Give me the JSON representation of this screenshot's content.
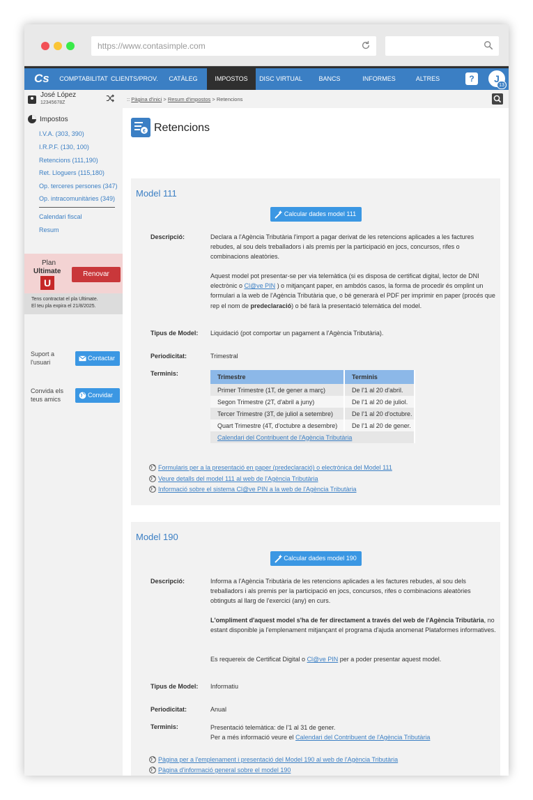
{
  "browser": {
    "url": "https://www.contasimple.com"
  },
  "nav": {
    "logo": "Cs",
    "items": [
      "COMPTABILITAT",
      "CLIENTS/PROV.",
      "CATÀLEG",
      "IMPOSTOS",
      "DISC VIRTUAL",
      "BANCS",
      "INFORMES",
      "ALTRES"
    ],
    "active": "IMPOSTOS",
    "help": "?",
    "avatar_initial": "J",
    "avatar_badge": "13"
  },
  "sidebar": {
    "user_name": "José López",
    "user_id": "12345678Z",
    "section_title": "Impostos",
    "links": [
      "I.V.A. (303, 390)",
      "I.R.P.F. (130, 100)",
      "Retencions (111,190)",
      "Ret. Lloguers (115,180)",
      "Op. terceres persones (347)",
      "Op. intracomunitàries (349)"
    ],
    "links2": [
      "Calendari fiscal",
      "Resum"
    ],
    "plan_label": "Plan",
    "plan_name": "Ultimate",
    "plan_badge": "U",
    "renew": "Renovar",
    "plan_note_1": "Tens contractat el pla Ultimate.",
    "plan_note_2": "El teu pla expira el 21/8/2025.",
    "support_1": "Suport a",
    "support_2": "l'usuari",
    "contact": "Contactar",
    "invite_1": "Convida els",
    "invite_2": "teus amics",
    "invite": "Convidar"
  },
  "breadcrumb": {
    "prefix": "::",
    "home": "Pàgina d'inici",
    "sep": ">",
    "summary": "Resum d'impostos",
    "current": "Retencions"
  },
  "page_title": "Retencions",
  "model111": {
    "title": "Model 111",
    "calc": "Calcular dades model 111",
    "desc_label": "Descripció:",
    "desc_p1": "Declara a l'Agència Tributària l'import a pagar derivat de les retencions aplicades a les factures rebudes, al sou dels treballadors i als premis per la participació en jocs, concursos, rifes o combinacions aleatòries.",
    "desc_p2a": "Aquest model pot presentar-se per via telemàtica (si es disposa de certificat digital, lector de DNI electrònic o ",
    "desc_p2_link": "Cl@ve PIN",
    "desc_p2b": " ) o mitjançant paper, en ambdós casos, la forma de procedir és omplint un formulari a la web de l'Agència Tributària que, o bé generarà el PDF per imprimir en paper (procés que rep el nom de ",
    "desc_p2_bold": "predeclaració",
    "desc_p2c": ") o bé farà la presentació telemàtica del model.",
    "type_label": "Tipus de Model:",
    "type": "Liquidació (pot comportar un pagament a l'Agència Tributària).",
    "period_label": "Periodicitat:",
    "period": "Trimestral",
    "terms_label": "Terminis:",
    "table_headers": [
      "Trimestre",
      "Terminis"
    ],
    "table_rows": [
      [
        "Primer Trimestre (1T, de gener a març)",
        "De l'1 al 20 d'abril."
      ],
      [
        "Segon Trimestre (2T, d'abril a juny)",
        "De l'1 al 20 de juliol."
      ],
      [
        "Tercer Trimestre (3T, de juliol a setembre)",
        "De l'1 al 20 d'octubre."
      ],
      [
        "Quart Trimestre (4T, d'octubre a desembre)",
        "De l'1 al 20 de gener."
      ]
    ],
    "table_link": "Calendari del Contribuent de l'Agència Tributària",
    "links": [
      "Formularis per a la presentació en paper (predeclaració) o electrònica del Model 111",
      "Veure detalls del model 111 al web de l'Agència Tributària",
      "Informació sobre el sistema Cl@ve PIN a la web de l'Agència Tributària"
    ]
  },
  "model190": {
    "title": "Model 190",
    "calc": "Calcular dades model 190",
    "desc_label": "Descripció:",
    "desc_p1": "Informa a l'Agència Tributària de les retencions aplicades a les factures rebudes, al sou dels treballadors i als premis per la participació en jocs, concursos, rifes o combinacions aleatòries obtinguts al llarg de l'exercici (any) en curs.",
    "desc_p2_bold": "L'ompliment d'aquest model s'ha de fer directament a través del web de l'Agència Tributària",
    "desc_p2": ", no estant disponible ja l'emplenament mitjançant el programa d'ajuda anomenat Plataformes informatives.",
    "desc_p3a": "Es requereix de Certificat Digital o ",
    "desc_p3_link": "Cl@ve PIN",
    "desc_p3b": " per a poder presentar aquest model.",
    "type_label": "Tipus de Model:",
    "type": "Informatiu",
    "period_label": "Periodicitat:",
    "period": "Anual",
    "terms_label": "Terminis:",
    "terms_1": "Presentació telemàtica: de l'1 al 31 de gener.",
    "terms_2a": "Per a més informació veure el ",
    "terms_2_link": "Calendari del Contribuent de l'Agència Tributària",
    "links": [
      "Pàgina per a l'emplenament i presentació del Model 190 al web de l'Agència Tributària",
      "Pàgina d'informació general sobre el model 190"
    ]
  }
}
